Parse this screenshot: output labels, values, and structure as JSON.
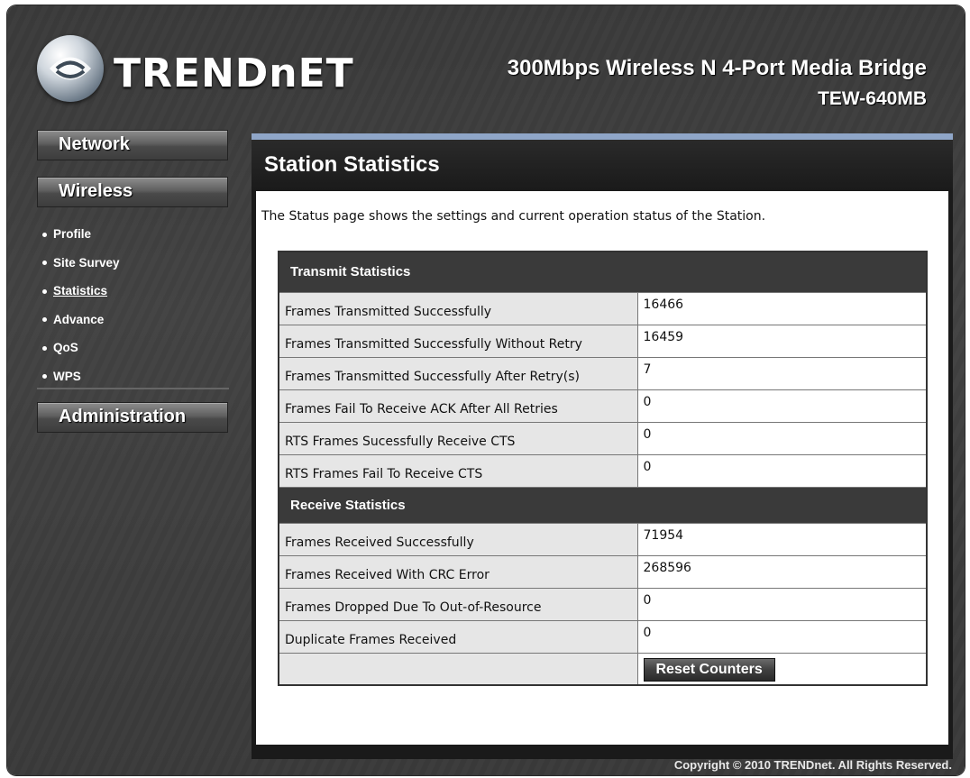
{
  "header": {
    "logo_text": "TRENDnET",
    "product_name": "300Mbps Wireless N 4-Port Media Bridge",
    "model": "TEW-640MB"
  },
  "sidebar": {
    "network": "Network",
    "wireless": "Wireless",
    "wireless_items": [
      {
        "label": "Profile",
        "active": false
      },
      {
        "label": "Site Survey",
        "active": false
      },
      {
        "label": "Statistics",
        "active": true
      },
      {
        "label": "Advance",
        "active": false
      },
      {
        "label": "QoS",
        "active": false
      },
      {
        "label": "WPS",
        "active": false
      }
    ],
    "administration": "Administration"
  },
  "main": {
    "title": "Station Statistics",
    "description": "The Status page shows the settings and current operation status of the Station.",
    "transmit_header": "Transmit Statistics",
    "transmit_rows": [
      {
        "label": "Frames Transmitted Successfully",
        "value": "16466"
      },
      {
        "label": "Frames Transmitted Successfully Without Retry",
        "value": "16459"
      },
      {
        "label": "Frames Transmitted Successfully After Retry(s)",
        "value": "7"
      },
      {
        "label": "Frames Fail To Receive ACK After All Retries",
        "value": "0"
      },
      {
        "label": "RTS Frames Sucessfully Receive CTS",
        "value": "0"
      },
      {
        "label": "RTS Frames Fail To Receive CTS",
        "value": "0"
      }
    ],
    "receive_header": "Receive Statistics",
    "receive_rows": [
      {
        "label": "Frames Received Successfully",
        "value": "71954"
      },
      {
        "label": "Frames Received With CRC Error",
        "value": "268596"
      },
      {
        "label": "Frames Dropped Due To Out-of-Resource",
        "value": "0"
      },
      {
        "label": "Duplicate Frames Received",
        "value": "0"
      }
    ],
    "reset_button": "Reset Counters"
  },
  "footer": {
    "copyright": "Copyright © 2010 TRENDnet. All Rights Reserved."
  },
  "colors": {
    "accent_bar": "#8fa6c8",
    "frame_bg": "#3a3a3a",
    "section_header_bg": "#3a3a3a"
  }
}
